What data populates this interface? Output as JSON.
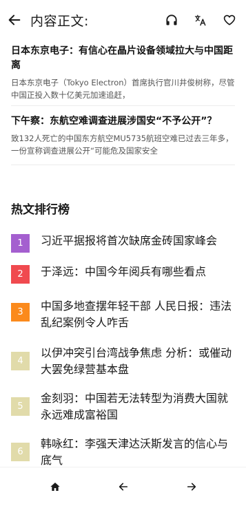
{
  "header": {
    "title": "内容正文:",
    "icons": [
      "back-arrow-icon",
      "headphones-icon",
      "translate-icon",
      "heart-icon"
    ]
  },
  "related": [
    {
      "title": "日本东京电子：有信心在晶片设备领域拉大与中国距离",
      "snippet": "日本东京电子（Tokyo Electron）首席执行官川井俊树称，尽管中国正投入数十亿美元加速追赶，"
    },
    {
      "title": "下午察：东航空难调查进展涉国安“不予公开”？",
      "snippet": "致132人死亡的中国东方航空MU5735航班空难已过去三年多，一份宣称调查进展公开“可能危及国家安全"
    }
  ],
  "hot": {
    "heading": "热文排行榜",
    "items": [
      {
        "rank": "1",
        "color": "#a45fcf",
        "title": "习近平据报将首次缺席金砖国家峰会"
      },
      {
        "rank": "2",
        "color": "#f04a4f",
        "title": "于泽远：中国今年阅兵有哪些看点"
      },
      {
        "rank": "3",
        "color": "#fb8a1c",
        "title": "中国多地查摆年轻干部 人民日报：违法乱纪案例令人咋舌"
      },
      {
        "rank": "4",
        "color": "#e1dbaa",
        "title": "以伊冲突引台湾战争焦虑 分析：或催动大罢免绿营基本盘"
      },
      {
        "rank": "5",
        "color": "#e1dbaa",
        "title": "金刻羽：中国若无法转型为消费大国就永远难成富裕国"
      },
      {
        "rank": "6",
        "color": "#e1dbaa",
        "title": "韩咏红：李强天津达沃斯发言的信心与底气"
      }
    ]
  },
  "bottom_nav": {
    "icons": [
      "home-icon",
      "back-arrow-icon",
      "forward-arrow-icon"
    ]
  }
}
